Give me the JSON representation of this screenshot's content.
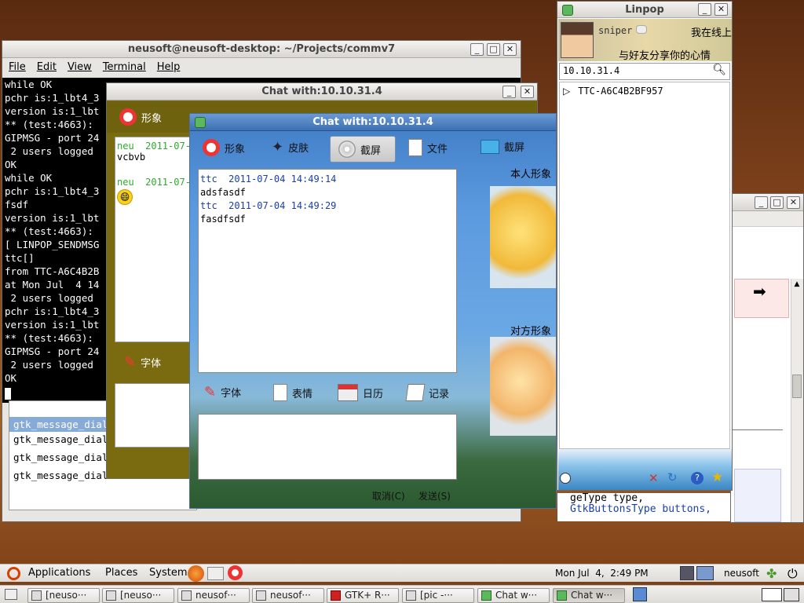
{
  "terminal": {
    "title": "neusoft@neusoft-desktop: ~/Projects/commv7",
    "menu": [
      "File",
      "Edit",
      "View",
      "Terminal",
      "Help"
    ],
    "lines": [
      "while OK",
      "pchr is:1_lbt4_3",
      "version is:1_lbt",
      "** (test:4663): ",
      "GIPMSG - port 24",
      " 2 users logged ",
      "OK",
      "while OK",
      "pchr is:1_lbt4_3",
      "fsdf",
      "version is:1_lbt",
      "** (test:4663): ",
      "[ LINPOP_SENDMSG",
      "ttc[]",
      "from TTC-A6C4B2B",
      "at Mon Jul  4 14",
      " 2 users logged ",
      "pchr is:1_lbt4_3",
      "version is:1_lbt",
      "** (test:4663): ",
      "GIPMSG - port 24",
      " 2 users logged ",
      "OK"
    ],
    "list": [
      "gtk_message_dialo",
      "gtk_message_dialo",
      "gtk_message_dialo",
      "gtk_message_dialo"
    ]
  },
  "chat_back": {
    "title": "Chat with:10.10.31.4",
    "tool_face": "形象",
    "msg1_meta": "neu  2011-07-0",
    "msg1_text": "vcbvb",
    "msg2_meta": "neu  2011-07-0",
    "font_label": "字体"
  },
  "chat": {
    "title": "Chat with:10.10.31.4",
    "toolbar": [
      "形象",
      "皮肤",
      "截屏",
      "文件",
      "截屏"
    ],
    "self_label": "本人形象",
    "other_label": "对方形象",
    "messages": [
      {
        "meta": "ttc  2011-07-04 14:49:14",
        "text": "adsfasdf"
      },
      {
        "meta": "ttc  2011-07-04 14:49:29",
        "text": "fasdfsdf"
      }
    ],
    "bottom_tools": [
      "字体",
      "表情",
      "日历",
      "记录"
    ],
    "cancel": "取消(C)",
    "send": "发送(S)"
  },
  "linpop": {
    "title": "Linpop",
    "user": "sniper",
    "status": "我在线上",
    "motto": "与好友分享你的心情",
    "search": "10.10.31.4",
    "tree_item": "TTC-A6C4B2BF957"
  },
  "editor": {
    "code1": "geType type,",
    "code2": "GtkButtonsType buttons,"
  },
  "top_panel": {
    "menus": [
      "Applications",
      "Places",
      "System"
    ],
    "clock": "Mon Jul  4,  2:49 PM",
    "user": "neusoft"
  },
  "taskbar": [
    "[neuso···",
    "[neuso···",
    "neusof···",
    "neusof···",
    "GTK+ R···",
    "[pic -···",
    "Chat w···",
    "Chat w···"
  ],
  "colors": {
    "terminal_bg": "#000000",
    "chat_meta": "#1a3ea8",
    "back_meta": "#2fa82f"
  }
}
